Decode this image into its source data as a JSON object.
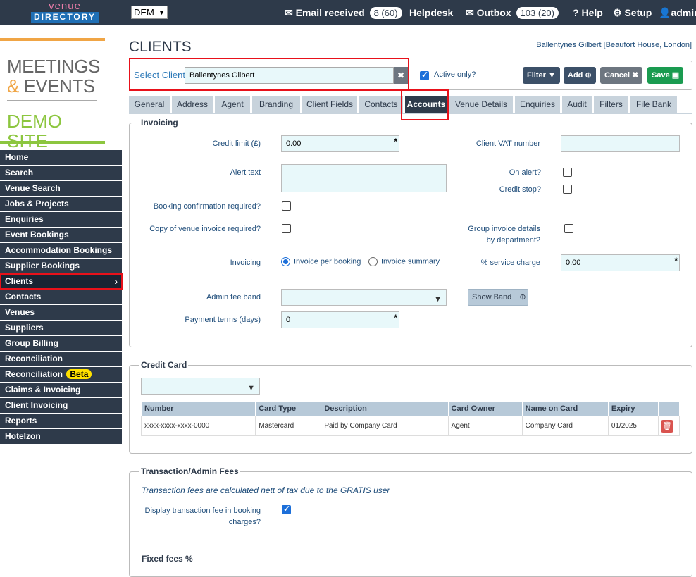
{
  "topbar": {
    "logo_top": "venue",
    "logo_bottom": "DIRECTORY",
    "site_select": "DEM",
    "email_label": "Email received",
    "email_badge": "8 (60)",
    "helpdesk": "Helpdesk",
    "outbox_label": "Outbox",
    "outbox_badge": "103 (20)",
    "help": "Help",
    "setup": "Setup",
    "admin": "admin"
  },
  "brand": {
    "line1": "MEETINGS",
    "line2_amp": "&",
    "line2": "EVENTS",
    "demo": "DEMO SITE"
  },
  "sidebar": {
    "items": [
      {
        "label": "Home"
      },
      {
        "label": "Search"
      },
      {
        "label": "Venue Search"
      },
      {
        "label": "Jobs & Projects"
      },
      {
        "label": "Enquiries"
      },
      {
        "label": "Event Bookings"
      },
      {
        "label": "Accommodation Bookings"
      },
      {
        "label": "Supplier Bookings"
      },
      {
        "label": "Clients"
      },
      {
        "label": "Contacts"
      },
      {
        "label": "Venues"
      },
      {
        "label": "Suppliers"
      },
      {
        "label": "Group Billing"
      },
      {
        "label": "Reconciliation"
      },
      {
        "label": "Reconciliation",
        "badge": "Beta"
      },
      {
        "label": "Claims & Invoicing"
      },
      {
        "label": "Client Invoicing"
      },
      {
        "label": "Reports"
      },
      {
        "label": "Hotelzon"
      }
    ]
  },
  "page": {
    "title": "CLIENTS",
    "client_info": "Ballentynes Gilbert [Beaufort House, London]"
  },
  "toolbar": {
    "select_label": "Select Client",
    "client_value": "Ballentynes Gilbert",
    "active_only": "Active only?",
    "filter": "Filter",
    "add": "Add",
    "cancel": "Cancel",
    "save": "Save"
  },
  "tabs": [
    "General",
    "Address",
    "Agent",
    "Branding",
    "Client Fields",
    "Contacts",
    "Accounts",
    "Venue Details",
    "Enquiries",
    "Audit",
    "Filters",
    "File Bank"
  ],
  "invoicing": {
    "legend": "Invoicing",
    "credit_limit_label": "Credit limit (£)",
    "credit_limit_value": "0.00",
    "vat_label": "Client VAT number",
    "vat_value": "",
    "alert_text_label": "Alert text",
    "on_alert_label": "On alert?",
    "credit_stop_label": "Credit stop?",
    "booking_conf_label": "Booking confirmation required?",
    "copy_invoice_label": "Copy of venue invoice required?",
    "group_invoice_label1": "Group invoice details",
    "group_invoice_label2": "by department?",
    "invoicing_label": "Invoicing",
    "radio_per_booking": "Invoice per booking",
    "radio_summary": "Invoice summary",
    "service_charge_label": "% service charge",
    "service_charge_value": "0.00",
    "admin_fee_label": "Admin fee band",
    "admin_fee_value": "",
    "show_band": "Show Band",
    "payment_terms_label": "Payment terms (days)",
    "payment_terms_value": "0"
  },
  "credit_card": {
    "legend": "Credit Card",
    "select_value": "",
    "columns": [
      "Number",
      "Card Type",
      "Description",
      "Card Owner",
      "Name on Card",
      "Expiry"
    ],
    "rows": [
      [
        "xxxx-xxxx-xxxx-0000",
        "Mastercard",
        "Paid by Company Card",
        "Agent",
        "Company Card",
        "01/2025"
      ]
    ]
  },
  "transaction": {
    "legend": "Transaction/Admin Fees",
    "note": "Transaction fees are calculated nett of tax due to the GRATIS user",
    "display_fee_label1": "Display transaction fee in booking",
    "display_fee_label2": "charges?",
    "fixed_fees": "Fixed fees %"
  },
  "colors": {
    "nav": "#2e3a4a",
    "highlight": "#e8111a",
    "save": "#1a9b50",
    "filter": "#3c5068",
    "cancel": "#6d7680"
  }
}
